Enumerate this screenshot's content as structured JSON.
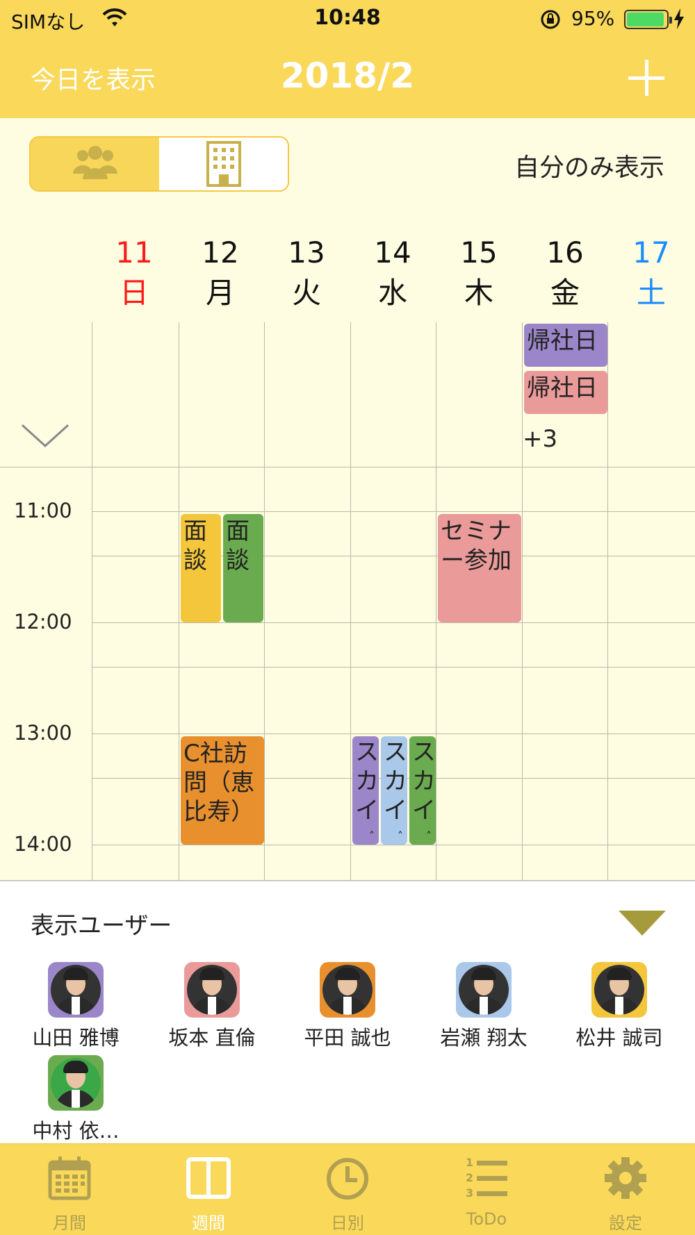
{
  "status_bar": {
    "carrier": "SIMなし",
    "time": "10:48",
    "battery": "95%",
    "battery_level": 0.95
  },
  "nav": {
    "today_label": "今日を表示",
    "title": "2018/2"
  },
  "filter": {
    "only_me_label": "自分のみ表示",
    "selected_segment": "building"
  },
  "week": {
    "days": [
      {
        "num": "11",
        "weekday": "日",
        "color": "#ff1a1a"
      },
      {
        "num": "12",
        "weekday": "月",
        "color": "#111111"
      },
      {
        "num": "13",
        "weekday": "火",
        "color": "#111111"
      },
      {
        "num": "14",
        "weekday": "水",
        "color": "#111111"
      },
      {
        "num": "15",
        "weekday": "木",
        "color": "#111111"
      },
      {
        "num": "16",
        "weekday": "金",
        "color": "#111111"
      },
      {
        "num": "17",
        "weekday": "土",
        "color": "#1a8cff"
      }
    ]
  },
  "all_day": {
    "events": [
      {
        "title": "帰社日",
        "color": "#9b86c9"
      },
      {
        "title": "帰社日",
        "color": "#eb9a9a"
      }
    ],
    "more": "+3"
  },
  "time_labels": [
    "11:00",
    "12:00",
    "13:00",
    "14:00"
  ],
  "events": [
    {
      "title": "面談",
      "color": "#f3c63b"
    },
    {
      "title": "面談",
      "color": "#6aab4f"
    },
    {
      "title": "セミナー参加",
      "color": "#eb9a9a"
    },
    {
      "title": "C社訪問（恵比寿）",
      "color": "#e8902e"
    },
    {
      "title": "スカイ",
      "color": "#9b86c9",
      "tail": "˄"
    },
    {
      "title": "スカイ",
      "color": "#a9c8ea",
      "tail": "˄"
    },
    {
      "title": "スカイ",
      "color": "#6aab4f",
      "tail": "˄"
    }
  ],
  "users_panel": {
    "heading": "表示ユーザー",
    "users": [
      {
        "name": "山田 雅博",
        "frame": "#9b86c9"
      },
      {
        "name": "坂本 直倫",
        "frame": "#eb9a9a"
      },
      {
        "name": "平田 誠也",
        "frame": "#e8902e"
      },
      {
        "name": "岩瀬 翔太",
        "frame": "#a9c8ea"
      },
      {
        "name": "松井 誠司",
        "frame": "#f3c63b"
      },
      {
        "name": "中村 依…",
        "frame": "#6aab4f"
      }
    ]
  },
  "tabs": [
    {
      "label": "月間",
      "icon": "calendar-icon",
      "active": false
    },
    {
      "label": "週間",
      "icon": "week-columns-icon",
      "active": true
    },
    {
      "label": "日別",
      "icon": "clock-icon",
      "active": false
    },
    {
      "label": "ToDo",
      "icon": "numbered-list-icon",
      "active": false
    },
    {
      "label": "設定",
      "icon": "gear-icon",
      "active": false
    }
  ],
  "colors": {
    "primary": "#f9d85a",
    "calendar_bg": "#fefde2",
    "inactive_tab": "#b0a050"
  }
}
